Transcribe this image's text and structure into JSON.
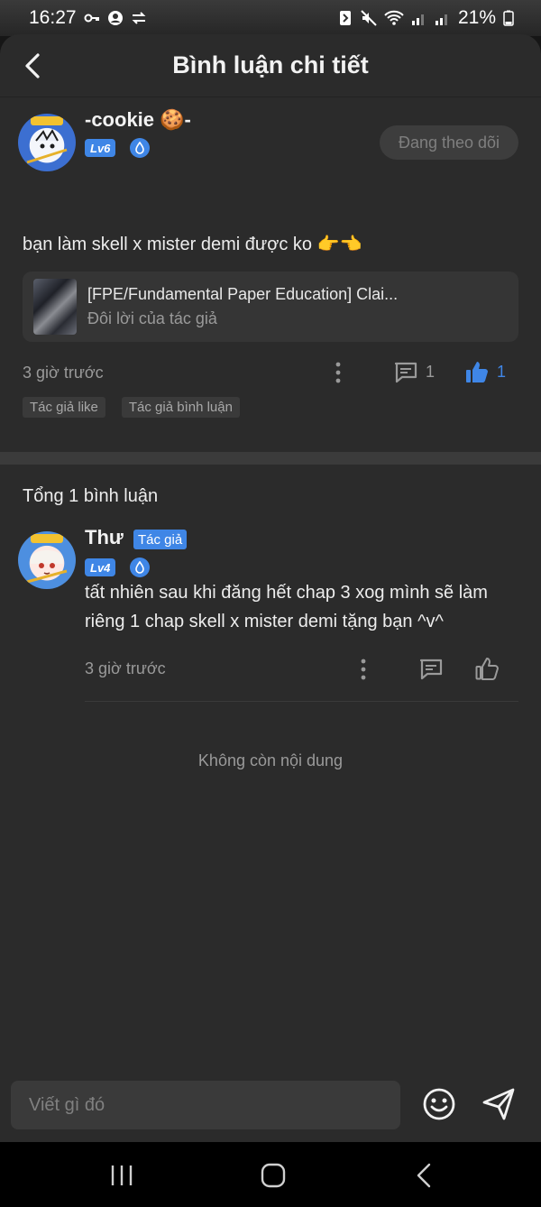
{
  "status_bar": {
    "time": "16:27",
    "battery": "21%"
  },
  "header": {
    "title": "Bình luận chi tiết"
  },
  "comment": {
    "username": "-cookie 🍪-",
    "level": "Lv6",
    "follow_label": "Đang theo dõi",
    "text": "bạn làm skell x mister demi được ko 👉👈",
    "reference": {
      "title": "[FPE/Fundamental Paper Education] Clai...",
      "subtitle": "Đôi lời của tác giả"
    },
    "time": "3 giờ trước",
    "reply_count": "1",
    "like_count": "1",
    "tags": [
      "Tác giả like",
      "Tác giả bình luận"
    ]
  },
  "total_label": "Tổng 1 bình luận",
  "reply": {
    "username": "Thư",
    "author_tag": "Tác giả",
    "level": "Lv4",
    "text": "tất nhiên sau khi đăng hết chap 3 xog mình sẽ làm riêng 1 chap skell x mister demi tặng bạn ^v^",
    "time": "3 giờ trước"
  },
  "end_label": "Không còn nội dung",
  "composer": {
    "placeholder": "Viết gì đó"
  },
  "colors": {
    "accent": "#3f86e6",
    "background": "#2b2b2b"
  }
}
